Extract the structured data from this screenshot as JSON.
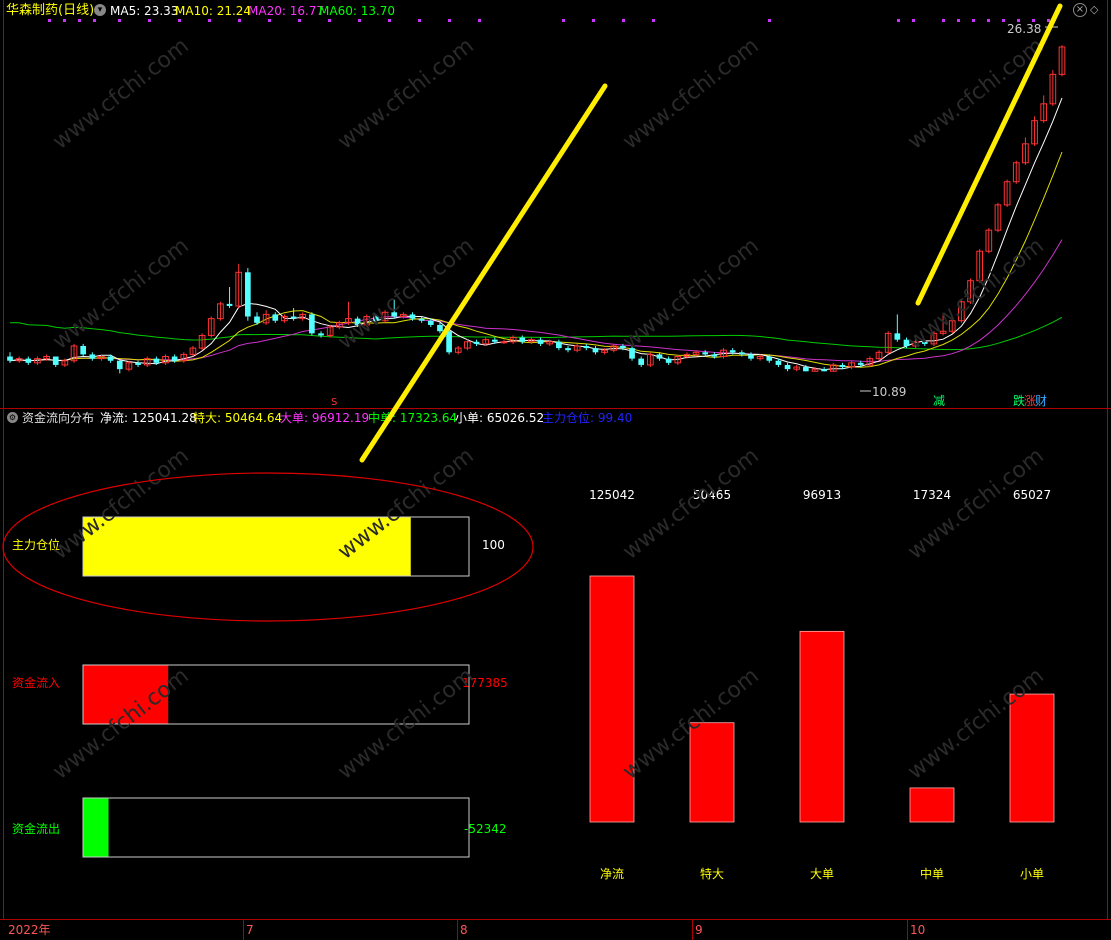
{
  "header": {
    "stock_title": "华森制药(日线)",
    "ma": [
      {
        "label": "MA5: 23.33",
        "color": "#ffffff"
      },
      {
        "label": "MA10: 21.24",
        "color": "#ffff00"
      },
      {
        "label": "MA20: 16.77",
        "color": "#ff33ff"
      },
      {
        "label": "MA60: 13.70",
        "color": "#00ff00"
      }
    ]
  },
  "price_chart": {
    "type": "candlestick",
    "high_label": "26.38",
    "low_label": "10.89",
    "ylim": [
      10.2,
      27.2
    ],
    "signal_labels": [
      "减",
      "跌",
      "涨",
      "财"
    ],
    "marker_s": "S",
    "candles": [
      [
        11.6,
        11.4,
        11.8,
        11.3
      ],
      [
        11.4,
        11.5,
        11.6,
        11.3
      ],
      [
        11.5,
        11.3,
        11.6,
        11.2
      ],
      [
        11.3,
        11.5,
        11.6,
        11.2
      ],
      [
        11.5,
        11.6,
        11.7,
        11.4
      ],
      [
        11.6,
        11.2,
        11.6,
        11.1
      ],
      [
        11.2,
        11.4,
        11.5,
        11.1
      ],
      [
        11.4,
        12.1,
        12.2,
        11.3
      ],
      [
        12.1,
        11.7,
        12.2,
        11.6
      ],
      [
        11.7,
        11.5,
        11.8,
        11.4
      ],
      [
        11.5,
        11.6,
        11.7,
        11.4
      ],
      [
        11.6,
        11.4,
        11.7,
        11.3
      ],
      [
        11.4,
        11.0,
        11.4,
        10.8
      ],
      [
        11.0,
        11.3,
        11.4,
        10.9
      ],
      [
        11.3,
        11.2,
        11.4,
        11.1
      ],
      [
        11.2,
        11.5,
        11.6,
        11.1
      ],
      [
        11.5,
        11.3,
        11.6,
        11.2
      ],
      [
        11.3,
        11.6,
        11.7,
        11.2
      ],
      [
        11.6,
        11.4,
        11.7,
        11.3
      ],
      [
        11.4,
        11.7,
        11.8,
        11.3
      ],
      [
        11.7,
        12.0,
        12.1,
        11.6
      ],
      [
        12.0,
        12.6,
        12.7,
        11.9
      ],
      [
        12.6,
        13.4,
        13.5,
        12.5
      ],
      [
        13.4,
        14.1,
        14.2,
        13.3
      ],
      [
        14.1,
        14.0,
        14.9,
        13.9
      ],
      [
        14.0,
        15.6,
        16.0,
        13.9
      ],
      [
        15.6,
        13.5,
        15.8,
        13.3
      ],
      [
        13.5,
        13.2,
        13.7,
        13.1
      ],
      [
        13.2,
        13.6,
        13.8,
        13.1
      ],
      [
        13.6,
        13.3,
        13.7,
        13.2
      ],
      [
        13.3,
        13.5,
        13.6,
        13.2
      ],
      [
        13.5,
        13.4,
        13.9,
        13.3
      ],
      [
        13.4,
        13.6,
        13.7,
        13.3
      ],
      [
        13.6,
        12.7,
        13.7,
        12.6
      ],
      [
        12.7,
        12.6,
        12.8,
        12.5
      ],
      [
        12.6,
        13.0,
        13.1,
        12.5
      ],
      [
        13.0,
        13.2,
        13.3,
        12.9
      ],
      [
        13.2,
        13.4,
        14.2,
        13.1
      ],
      [
        13.4,
        13.1,
        13.5,
        13.0
      ],
      [
        13.1,
        13.5,
        13.6,
        13.0
      ],
      [
        13.5,
        13.3,
        13.6,
        13.2
      ],
      [
        13.3,
        13.7,
        13.8,
        13.2
      ],
      [
        13.7,
        13.5,
        14.3,
        13.4
      ],
      [
        13.5,
        13.6,
        13.7,
        13.4
      ],
      [
        13.6,
        13.4,
        13.7,
        13.3
      ],
      [
        13.4,
        13.3,
        13.5,
        13.2
      ],
      [
        13.3,
        13.1,
        13.4,
        13.0
      ],
      [
        13.1,
        12.8,
        13.2,
        12.7
      ],
      [
        12.8,
        11.8,
        12.9,
        11.7
      ],
      [
        11.8,
        12.0,
        12.1,
        11.7
      ],
      [
        12.0,
        12.3,
        12.4,
        11.9
      ],
      [
        12.3,
        12.2,
        12.4,
        12.1
      ],
      [
        12.2,
        12.4,
        12.5,
        12.1
      ],
      [
        12.4,
        12.3,
        12.5,
        12.2
      ],
      [
        12.3,
        12.3,
        12.4,
        12.2
      ],
      [
        12.3,
        12.5,
        12.6,
        12.2
      ],
      [
        12.5,
        12.3,
        12.6,
        12.2
      ],
      [
        12.3,
        12.4,
        12.5,
        12.2
      ],
      [
        12.4,
        12.2,
        12.5,
        12.1
      ],
      [
        12.2,
        12.3,
        12.4,
        12.1
      ],
      [
        12.3,
        12.0,
        12.4,
        11.9
      ],
      [
        12.0,
        11.9,
        12.1,
        11.8
      ],
      [
        11.9,
        12.1,
        12.2,
        11.8
      ],
      [
        12.1,
        12.0,
        12.2,
        11.9
      ],
      [
        12.0,
        11.8,
        12.1,
        11.7
      ],
      [
        11.8,
        11.9,
        12.0,
        11.7
      ],
      [
        11.9,
        12.1,
        12.2,
        11.8
      ],
      [
        12.1,
        12.0,
        12.2,
        11.9
      ],
      [
        12.0,
        11.5,
        12.1,
        11.4
      ],
      [
        11.5,
        11.2,
        11.6,
        11.1
      ],
      [
        11.2,
        11.7,
        11.8,
        11.1
      ],
      [
        11.7,
        11.5,
        11.8,
        11.4
      ],
      [
        11.5,
        11.3,
        11.6,
        11.2
      ],
      [
        11.3,
        11.6,
        11.7,
        11.2
      ],
      [
        11.6,
        11.7,
        11.8,
        11.5
      ],
      [
        11.7,
        11.8,
        11.9,
        11.6
      ],
      [
        11.8,
        11.7,
        11.9,
        11.6
      ],
      [
        11.7,
        11.6,
        11.8,
        11.5
      ],
      [
        11.6,
        11.9,
        12.0,
        11.5
      ],
      [
        11.9,
        11.8,
        12.0,
        11.7
      ],
      [
        11.8,
        11.7,
        11.9,
        11.6
      ],
      [
        11.7,
        11.5,
        11.8,
        11.4
      ],
      [
        11.5,
        11.6,
        11.7,
        11.4
      ],
      [
        11.6,
        11.4,
        11.7,
        11.3
      ],
      [
        11.4,
        11.2,
        11.5,
        11.1
      ],
      [
        11.2,
        11.0,
        11.3,
        10.9
      ],
      [
        11.0,
        11.1,
        11.2,
        10.9
      ],
      [
        11.1,
        10.9,
        11.2,
        10.89
      ],
      [
        10.9,
        11.0,
        11.1,
        10.89
      ],
      [
        11.0,
        10.9,
        11.1,
        10.89
      ],
      [
        10.9,
        11.2,
        11.3,
        10.9
      ],
      [
        11.2,
        11.1,
        11.3,
        11.0
      ],
      [
        11.1,
        11.3,
        11.4,
        11.0
      ],
      [
        11.3,
        11.2,
        11.4,
        11.1
      ],
      [
        11.2,
        11.5,
        11.6,
        11.1
      ],
      [
        11.5,
        11.8,
        11.9,
        11.4
      ],
      [
        11.8,
        12.7,
        12.8,
        11.7
      ],
      [
        12.7,
        12.4,
        13.6,
        12.3
      ],
      [
        12.4,
        12.1,
        12.5,
        12.0
      ],
      [
        12.1,
        12.3,
        12.4,
        12.0
      ],
      [
        12.3,
        12.2,
        12.4,
        12.1
      ],
      [
        12.2,
        12.7,
        12.8,
        12.1
      ],
      [
        12.7,
        12.8,
        13.6,
        12.6
      ],
      [
        12.8,
        13.3,
        13.4,
        12.7
      ],
      [
        13.3,
        14.2,
        14.3,
        13.2
      ],
      [
        14.2,
        15.2,
        15.3,
        14.1
      ],
      [
        15.2,
        16.6,
        16.7,
        15.1
      ],
      [
        16.6,
        17.6,
        17.7,
        16.5
      ],
      [
        17.6,
        18.8,
        18.9,
        17.5
      ],
      [
        18.8,
        19.9,
        20.0,
        18.7
      ],
      [
        19.9,
        20.8,
        20.9,
        19.8
      ],
      [
        20.8,
        21.7,
        22.0,
        20.7
      ],
      [
        21.7,
        22.8,
        23.0,
        21.6
      ],
      [
        22.8,
        23.6,
        24.0,
        22.7
      ],
      [
        23.6,
        25.0,
        25.2,
        23.5
      ],
      [
        25.0,
        26.3,
        26.38,
        24.9
      ]
    ]
  },
  "flow_header": {
    "title": "资金流向分布",
    "items": [
      {
        "label": "净流: 125041.28",
        "color": "#ffffff"
      },
      {
        "label": "特大: 50464.64",
        "color": "#ffff00"
      },
      {
        "label": "大单: 96912.19",
        "color": "#ff33ff"
      },
      {
        "label": "中单: 17323.64",
        "color": "#00ff00"
      },
      {
        "label": "小单: 65026.52",
        "color": "#ffffff"
      },
      {
        "label": "主力仓位: 99.40",
        "color": "#0000ff"
      }
    ]
  },
  "gauges": [
    {
      "label": "主力仓位",
      "value_text": "100",
      "fraction": 0.85,
      "fill": "#ffff00",
      "label_color": "#ffff00",
      "value_color": "#ffffff"
    },
    {
      "label": "资金流入",
      "value_text": "177385",
      "fraction": 0.22,
      "fill": "#ff0000",
      "label_color": "#ff0000",
      "value_color": "#ff0000"
    },
    {
      "label": "资金流出",
      "value_text": "-52342",
      "fraction": 0.065,
      "fill": "#00ff00",
      "label_color": "#00ff00",
      "value_color": "#00ff00"
    }
  ],
  "chart_data": {
    "type": "bar",
    "categories": [
      "净流",
      "特大",
      "大单",
      "中单",
      "小单"
    ],
    "values": [
      125042,
      50465,
      96913,
      17324,
      65027
    ],
    "value_labels": [
      "125042",
      "50465",
      "96913",
      "17324",
      "65027"
    ],
    "ylim": [
      0,
      125042
    ],
    "bar_color": "#ff0000"
  },
  "time_axis": {
    "labels": [
      "2022年",
      "7",
      "8",
      "9",
      "10"
    ]
  },
  "watermark": "www.cfchi.com"
}
